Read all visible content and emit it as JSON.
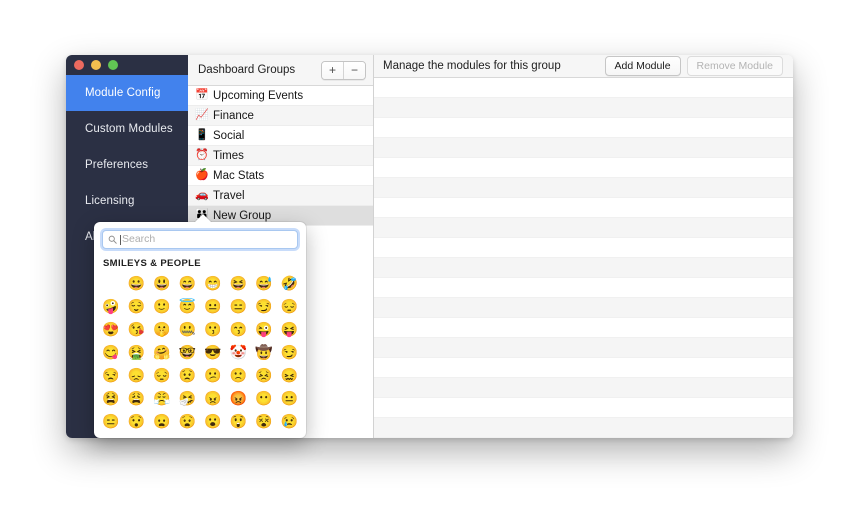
{
  "window": {
    "traffic_lights": [
      {
        "name": "close",
        "color": "#ec6a5f"
      },
      {
        "name": "minimize",
        "color": "#f3bf4f"
      },
      {
        "name": "maximize",
        "color": "#61c454"
      }
    ]
  },
  "sidebar": {
    "accent_color": "#4282ed",
    "background_color": "#2b3044",
    "items": [
      {
        "label": "Module Config",
        "selected": true
      },
      {
        "label": "Custom Modules",
        "selected": false
      },
      {
        "label": "Preferences",
        "selected": false
      },
      {
        "label": "Licensing",
        "selected": false
      },
      {
        "label": "About",
        "selected": false
      }
    ]
  },
  "groups_panel": {
    "title": "Dashboard Groups",
    "add_button_label": "+",
    "remove_button_label": "−",
    "rows": [
      {
        "emoji": "📅",
        "emoji_name": "calendar-icon",
        "label": "Upcoming Events",
        "selected": false
      },
      {
        "emoji": "📈",
        "emoji_name": "chart-up-icon",
        "label": "Finance",
        "selected": false
      },
      {
        "emoji": "📱",
        "emoji_name": "mobile-phone-icon",
        "label": "Social",
        "selected": false
      },
      {
        "emoji": "⏰",
        "emoji_name": "alarm-clock-icon",
        "label": "Times",
        "selected": false
      },
      {
        "emoji": "🍎",
        "emoji_name": "apple-icon",
        "label": "Mac Stats",
        "selected": false
      },
      {
        "emoji": "🚗",
        "emoji_name": "car-icon",
        "label": "Travel",
        "selected": false
      },
      {
        "emoji": "👪",
        "emoji_name": "family-icon",
        "label": "New Group",
        "selected": true
      }
    ]
  },
  "modules_panel": {
    "title": "Manage the modules for this group",
    "add_button_label": "Add Module",
    "remove_button_label": "Remove Module",
    "remove_button_disabled": true,
    "row_count": 18
  },
  "emoji_popover": {
    "search_placeholder": "Search",
    "search_value": "",
    "search_icon_name": "magnifier-icon",
    "section_title": "SMILEYS & PEOPLE",
    "columns": 8,
    "emojis": [
      "",
      "😀",
      "😃",
      "😄",
      "😁",
      "😆",
      "😅",
      "🤣",
      "🤪",
      "😌",
      "🙂",
      "😇",
      "😐",
      "😑",
      "😏",
      "😔",
      "😍",
      "😘",
      "🤫",
      "🤐",
      "😗",
      "😙",
      "😜",
      "😝",
      "😋",
      "🤮",
      "🤗",
      "🤓",
      "😎",
      "🤡",
      "🤠",
      "😏",
      "😒",
      "😞",
      "😔",
      "😟",
      "😕",
      "🙁",
      "😣",
      "😖",
      "😫",
      "😩",
      "😤",
      "🤧",
      "😠",
      "😡",
      "😶",
      "😐",
      "😑",
      "😯",
      "😦",
      "😧",
      "😮",
      "😲",
      "😵",
      "😢"
    ]
  }
}
